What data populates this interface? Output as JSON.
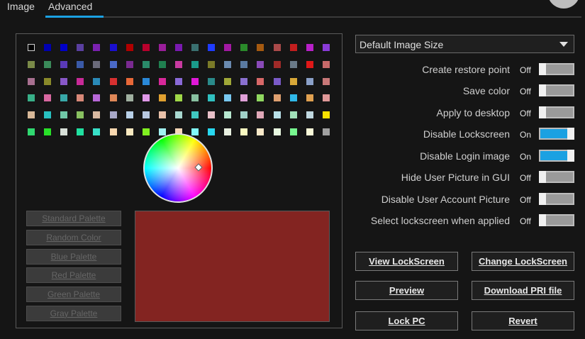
{
  "tabs": [
    {
      "label": "Image"
    },
    {
      "label": "Advanced"
    }
  ],
  "palette": {
    "rows": [
      [
        "#000000",
        "#0000b0",
        "#0000c8",
        "#5a3fa0",
        "#7b21b0",
        "#1a0fd0",
        "#b00000",
        "#b8002c",
        "#9a1e9a",
        "#7a1ab0",
        "#3a7070",
        "#1f3cff",
        "#a319a3",
        "#2a8a2a",
        "#a55a10",
        "#aa4a4a",
        "#c21e1e",
        "#b820c8",
        "#8a3bd8"
      ],
      [
        "#7a8a48",
        "#3a8a5a",
        "#5a3ab8",
        "#3a5aa8",
        "#6a6a7a",
        "#4a6ac8",
        "#7a2a90",
        "#2a8a6a",
        "#208050",
        "#c83aa0",
        "#1a9a8a",
        "#7a7a28",
        "#6a8ab0",
        "#5a7aa0",
        "#8a4ab8",
        "#a02a28",
        "#6a7a88",
        "#e01818",
        "#c86a6a"
      ],
      [
        "#a87090",
        "#8a8a2a",
        "#8858c8",
        "#c82a98",
        "#2a8ab8",
        "#d83030",
        "#e86838",
        "#2a88d8",
        "#d8289a",
        "#8a6ad8",
        "#e018d8",
        "#2a8a8a",
        "#a0a838",
        "#8a70d0",
        "#d86868",
        "#7a5ac8",
        "#d8a838",
        "#8aa0c8",
        "#c87878"
      ],
      [
        "#38b088",
        "#d868a0",
        "#38a8a8",
        "#d88878",
        "#b868d8",
        "#e08858",
        "#a0b0a0",
        "#e098e8",
        "#e0a030",
        "#a0d848",
        "#88c0a0",
        "#30c0c0",
        "#78c8f0",
        "#e0a0d8",
        "#90d860",
        "#e0a070",
        "#30b8e8",
        "#e0a050",
        "#e09898"
      ],
      [
        "#d8b898",
        "#28c0c0",
        "#70c8a8",
        "#88c060",
        "#d8b8a0",
        "#a8a8c8",
        "#b8d0e8",
        "#b8c8e0",
        "#e8c0a8",
        "#a8d8d0",
        "#40c8c0",
        "#e8c0c8",
        "#b8e8d0",
        "#a0d0c8",
        "#e0a8b8",
        "#b8e0e8",
        "#a0e0b8",
        "#c0d8e0",
        "#f8e000"
      ],
      [
        "#30d870",
        "#28e028",
        "#d8e0d8",
        "#20e0a0",
        "#38e0c8",
        "#f8d8b0",
        "#f8e8c0",
        "#80f020",
        "#a0f0f0",
        "#f8d8b8",
        "#80f8f8",
        "#28d8f0",
        "#e8f0e0",
        "#f8f8c0",
        "#f8e8c8",
        "#e8f8e0",
        "#78f890",
        "#f8f8d8",
        "#a0a0a0"
      ]
    ]
  },
  "palette_buttons": [
    {
      "label": "Standard Palette"
    },
    {
      "label": "Random Color"
    },
    {
      "label": "Blue Palette"
    },
    {
      "label": "Red Palette"
    },
    {
      "label": "Green Palette"
    },
    {
      "label": "Gray Palette"
    }
  ],
  "selected_color": "#832421",
  "image_size": {
    "selected": "Default Image Size"
  },
  "options": [
    {
      "label": "Create restore point",
      "state": "Off"
    },
    {
      "label": "Save color",
      "state": "Off"
    },
    {
      "label": "Apply to desktop",
      "state": "Off"
    },
    {
      "label": "Disable Lockscreen",
      "state": "On"
    },
    {
      "label": "Disable Login image",
      "state": "On"
    },
    {
      "label": "Hide User Picture in GUI",
      "state": "Off"
    },
    {
      "label": "Disable User Account Picture",
      "state": "Off"
    },
    {
      "label": "Select lockscreen when applied",
      "state": "Off"
    }
  ],
  "actions": [
    {
      "label": "View LockScreen"
    },
    {
      "label": "Change LockScreen"
    },
    {
      "label": "Preview"
    },
    {
      "label": "Download PRI file"
    },
    {
      "label": "Lock PC"
    },
    {
      "label": "Revert"
    }
  ],
  "colors": {
    "accent": "#1ba1e2",
    "background": "#151515"
  }
}
